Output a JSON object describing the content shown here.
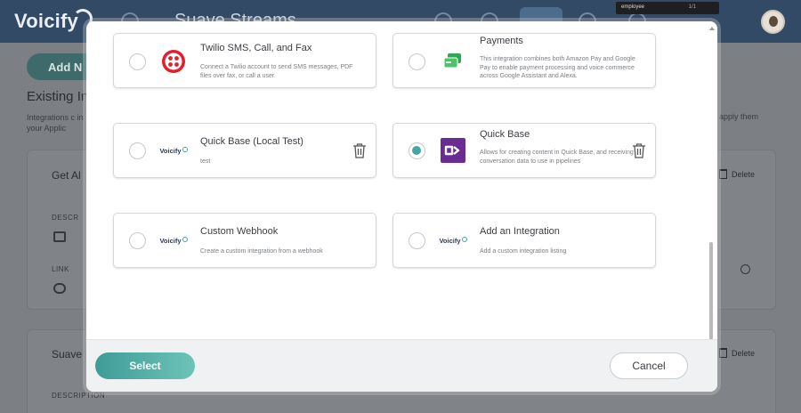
{
  "app": {
    "logo": "Voicify",
    "title": "Suave Streams",
    "add_button": "Add N",
    "section_heading": "Existing In",
    "section_sub": "Integrations c in your Applic",
    "section_sub_right": "apply them",
    "find_bar": {
      "value": "employee",
      "count": "1/1"
    }
  },
  "background_cards": [
    {
      "title": "Get Al",
      "delete": "Delete",
      "desc_label": "DESCR",
      "link_label": "LINK"
    },
    {
      "title": "Suave",
      "delete": "Delete",
      "desc_label": "DESCRIPTION"
    }
  ],
  "modal": {
    "integrations": [
      {
        "title": "Twilio SMS, Call, and Fax",
        "desc": "Connect a Twilio account to send SMS messages, PDF files over fax, or call a user.",
        "icon": "twilio-icon",
        "selected": false,
        "deletable": false
      },
      {
        "title": "Payments",
        "desc": "This integration combines both Amazon Pay and Google Pay to enable payment processing and voice commerce across Google Assistant and Alexa.",
        "icon": "payments-card-icon",
        "selected": false,
        "deletable": false
      },
      {
        "title": "Quick Base (Local Test)",
        "desc": "test",
        "icon": "voicify-logo-icon",
        "logo_text": "Voicify",
        "selected": false,
        "deletable": true
      },
      {
        "title": "Quick Base",
        "desc": "Allows for creating content in Quick Base, and receiving conversation data to use in pipelines",
        "icon": "quickbase-icon",
        "selected": true,
        "deletable": true
      },
      {
        "title": "Custom Webhook",
        "desc": "Create a custom integration from a webhook",
        "icon": "voicify-logo-icon",
        "logo_text": "Voicify",
        "selected": false,
        "deletable": false
      },
      {
        "title": "Add an Integration",
        "desc": "Add a custom integration listing",
        "icon": "voicify-logo-icon",
        "logo_text": "Voicify",
        "selected": false,
        "deletable": false
      }
    ],
    "select_label": "Select",
    "cancel_label": "Cancel"
  },
  "colors": {
    "accent": "#45a79f",
    "twilio_red": "#e31e2d",
    "quickbase_purple": "#6a2c91",
    "payments_green": "#2fa84f"
  }
}
